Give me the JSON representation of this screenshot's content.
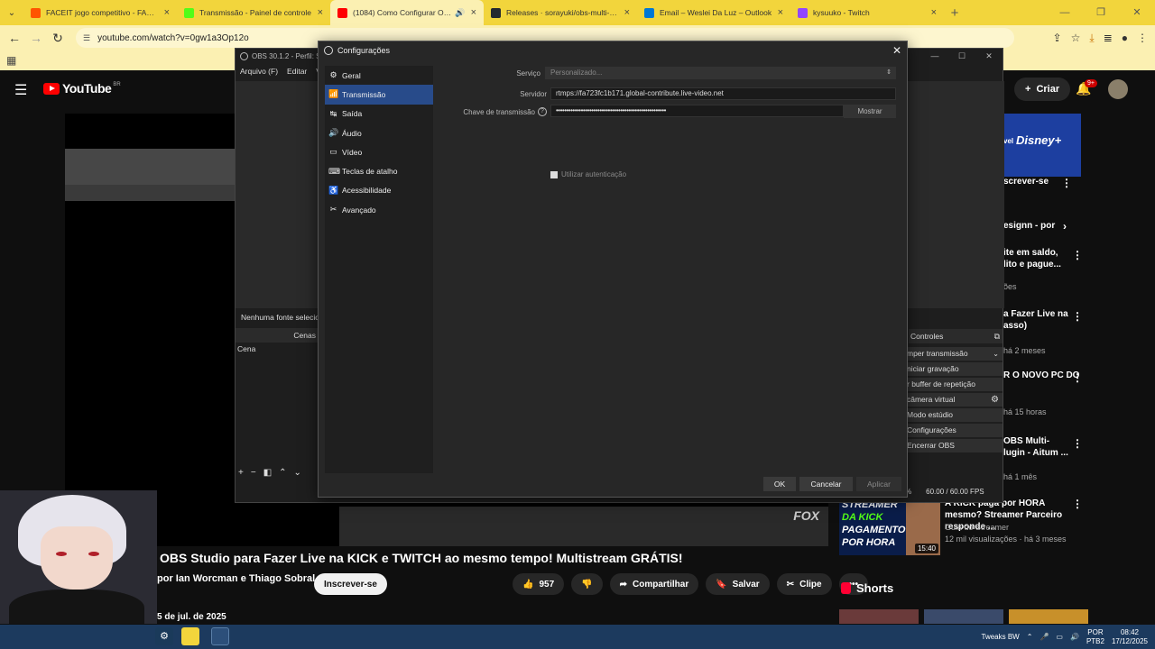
{
  "browser": {
    "tabs": [
      {
        "title": "FACEIT jogo competitivo - FACEIT",
        "color": "#ff5500",
        "active": false
      },
      {
        "title": "Transmissão - Painel de controle",
        "color": "#53fc18",
        "active": false
      },
      {
        "title": "(1084) Como Configurar OBS",
        "color": "#ff0000",
        "active": true
      },
      {
        "title": "Releases · sorayuki/obs-multi-rtmp",
        "color": "#24292f",
        "active": false
      },
      {
        "title": "Email – Weslei Da Luz – Outlook",
        "color": "#0078d4",
        "active": false
      },
      {
        "title": "kysuuko - Twitch",
        "color": "#9146ff",
        "active": false
      }
    ],
    "url": "youtube.com/watch?v=0gw1a3Op12o"
  },
  "youtube": {
    "logo": "YouTube",
    "country": "BR",
    "create_label": "Criar",
    "notif_badge": "9+",
    "video_title": "OBS Studio para Fazer Live na KICK e TWITCH ao mesmo tempo! Multistream GRÁTIS!",
    "channel": "por Ian Worcman e Thiago Sobral",
    "subscribe_label": "Inscrever-se",
    "likes": "957",
    "share_label": "Compartilhar",
    "save_label": "Salvar",
    "clip_label": "Clipe",
    "date": "5 de jul. de 2025",
    "watermark": "FOX",
    "sidebar": {
      "ad_logo": "Disney+",
      "ad_prefix": "vel",
      "subscribe_partial": "screver-se",
      "ad_text": "esignn - por",
      "items": [
        {
          "title": "ite em saldo,\nlito e pague...",
          "meta": "ões"
        },
        {
          "title": "a Fazer Live na\nasso)",
          "meta": "há 2 meses"
        },
        {
          "title": "R O NOVO PC DO",
          "meta": "há 15 horas"
        },
        {
          "title": "OBS Multi-\nlugin - Aitum ...",
          "meta": "há 1 mês"
        }
      ],
      "rec": {
        "thumb_lines": [
          "STREAMER",
          "DA KICK",
          "PAGAMENTO",
          "POR HORA"
        ],
        "duration": "15:40",
        "title": "A KICK paga por HORA mesmo? Streamer Parceiro responde ...",
        "channel": "Guia do Streamer",
        "meta": "12 mil visualizações · há 3 meses"
      },
      "shorts_label": "Shorts"
    }
  },
  "obs": {
    "title": "OBS 30.1.2 - Perfil: Sem título",
    "menu": [
      "Arquivo (F)",
      "Editar",
      "Vi"
    ],
    "no_source": "Nenhuma fonte selecionada",
    "scenes_header": "Cenas",
    "scene_name": "Cena",
    "controls_header": "Controles",
    "controls": [
      {
        "label": "mper transmissão",
        "extra": "arrow"
      },
      {
        "label": "niciar gravação",
        "extra": ""
      },
      {
        "label": "r buffer de repetição",
        "extra": ""
      },
      {
        "label": "câmera virtual",
        "extra": "gear"
      },
      {
        "label": "Modo estúdio",
        "extra": ""
      },
      {
        "label": "Configurações",
        "extra": ""
      },
      {
        "label": "Encerrar OBS",
        "extra": ""
      }
    ],
    "status_pct": "%",
    "fps": "60.00 / 60.00 FPS"
  },
  "settings": {
    "title": "Configurações",
    "nav": [
      {
        "label": "Geral",
        "icon": "gear-icon",
        "glyph": "⚙"
      },
      {
        "label": "Transmissão",
        "icon": "antenna-icon",
        "glyph": "📶",
        "selected": true
      },
      {
        "label": "Saída",
        "icon": "output-icon",
        "glyph": "↹"
      },
      {
        "label": "Áudio",
        "icon": "speaker-icon",
        "glyph": "🔊"
      },
      {
        "label": "Vídeo",
        "icon": "monitor-icon",
        "glyph": "▭"
      },
      {
        "label": "Teclas de atalho",
        "icon": "keyboard-icon",
        "glyph": "⌨"
      },
      {
        "label": "Acessibilidade",
        "icon": "accessibility-icon",
        "glyph": "♿"
      },
      {
        "label": "Avançado",
        "icon": "tools-icon",
        "glyph": "✂"
      }
    ],
    "service_label": "Serviço",
    "service_value": "Personalizado...",
    "server_label": "Servidor",
    "server_value": "rtmps://fa723fc1b171.global-contribute.live-video.net",
    "key_label": "Chave de transmissão",
    "key_value": "•••••••••••••••••••••••••••••••••••••••••••••••••••••",
    "show_label": "Mostrar",
    "auth_label": "Utilizar autenticação",
    "ok_label": "OK",
    "cancel_label": "Cancelar",
    "apply_label": "Aplicar"
  },
  "taskbar": {
    "tray_label": "Tweaks BW",
    "lang": "POR",
    "layout": "PTB2",
    "time": "08:42",
    "date": "17/12/2025"
  }
}
